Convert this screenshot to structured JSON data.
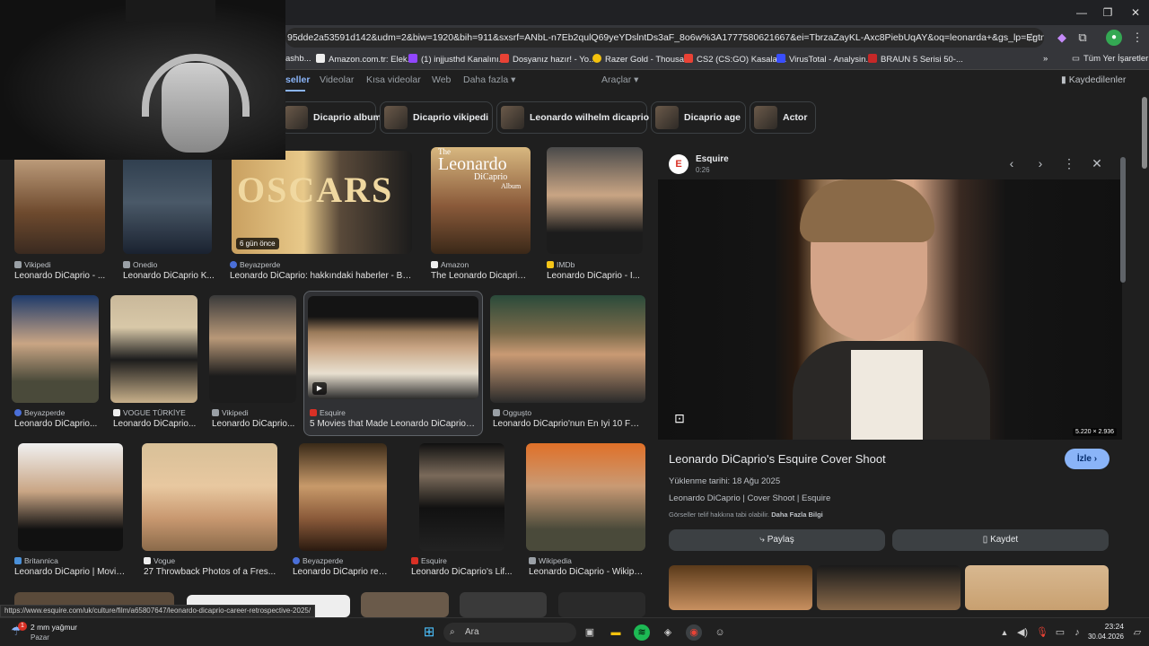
{
  "browser": {
    "url": "95dde2a53591d142&udm=2&biw=1920&bih=911&sxsrf=ANbL-n7Eb2qulQ69yeYDslntDs3aF_8o6w%3A1777580621667&ei=TbrzaZayKL-Axc8PiebUqAY&oq=leonarda+&gs_lp=Egtnd3Mtd2l6LWlt...",
    "bookmarks": [
      "ashb...",
      "Amazon.com.tr: Elek...",
      "(1) injjusthd Kanalını...",
      "Dosyanız hazır! - Yo...",
      "Razer Gold - Thousa...",
      "CS2 (CS:GO) Kasalar...",
      "VirusTotal - Analysin...",
      "BRAUN 5 Serisi 50-..."
    ],
    "all_bookmarks": "Tüm Yer İşaretleri",
    "status_url": "https://www.esquire.com/uk/culture/film/a65807647/leonardo-dicaprio-career-retrospective-2025/"
  },
  "tabs": {
    "items": [
      "seller",
      "Videolar",
      "Kısa videolar",
      "Web",
      "Daha fazla ▾"
    ],
    "tools": "Araçlar ▾",
    "saved": "Kaydedilenler"
  },
  "chips": [
    "Dicaprio album",
    "Dicaprio vikipedi",
    "Leonardo wilhelm dicaprio",
    "Dicaprio age",
    "Actor"
  ],
  "results": [
    {
      "src": "Vikipedi",
      "title": "Leonardo DiCaprio - ...",
      "color": "#9aa0a6"
    },
    {
      "src": "Onedio",
      "title": "Leonardo DiCaprio K...",
      "color": "#9aa0a6"
    },
    {
      "src": "Beyazperde",
      "title": "Leonardo DiCaprio: hakkındaki haberler - Bey...",
      "badge": "6 gün önce",
      "color": "#4a6fd8"
    },
    {
      "src": "Amazon",
      "title": "The Leonardo Dicaprio ...",
      "color": "#dddddd"
    },
    {
      "src": "IMDb",
      "title": "Leonardo DiCaprio - I...",
      "color": "#f5c518"
    },
    {
      "src": "Beyazperde",
      "title": "Leonardo DiCaprio...",
      "color": "#4a6fd8"
    },
    {
      "src": "VOGUE TÜRKİYE",
      "title": "Leonardo DiCaprio...",
      "color": "#dddddd"
    },
    {
      "src": "Vikipedi",
      "title": "Leonardo DiCaprio...",
      "color": "#9aa0a6"
    },
    {
      "src": "Esquire",
      "title": "5 Movies that Made Leonardo DiCaprio ...",
      "color": "#d93025"
    },
    {
      "src": "Ogguşto",
      "title": "Leonardo DiCaprio'nun En İyi 10 Fil...",
      "color": "#9aa0a6"
    },
    {
      "src": "Britannica",
      "title": "Leonardo DiCaprio | Movie...",
      "color": "#4a90d9"
    },
    {
      "src": "Vogue",
      "title": "27 Throwback Photos of a Fres...",
      "color": "#dddddd"
    },
    {
      "src": "Beyazperde",
      "title": "Leonardo DiCaprio resi...",
      "color": "#4a6fd8"
    },
    {
      "src": "Esquire",
      "title": "Leonardo DiCaprio's Lif...",
      "color": "#d93025"
    },
    {
      "src": "Wikipedia",
      "title": "Leonardo DiCaprio - Wikipe...",
      "color": "#9aa0a6"
    }
  ],
  "amazon_album": {
    "line1": "The",
    "line2": "Leonardo",
    "line3": "DiCaprio",
    "line4": "Album"
  },
  "oscars_text": "OSCARS",
  "panel": {
    "source": "Esquire",
    "duration": "0:26",
    "dimensions": "5.220 × 2.936",
    "title": "Leonardo DiCaprio's Esquire Cover Shoot",
    "watch": "İzle ›",
    "upload_date": "Yüklenme tarihi: 18 Ağu 2025",
    "subtitle": "Leonardo DiCaprio | Cover Shoot | Esquire",
    "copyright": "Görseller telif hakkına tabi olabilir.",
    "more_info": "Daha Fazla Bilgi",
    "share": "Paylaş",
    "save": "Kaydet"
  },
  "taskbar": {
    "weather_temp": "2 mm yağmur",
    "weather_day": "Pazar",
    "search": "Ara",
    "time": "23:24",
    "date": "30.04.2026",
    "badge": "1"
  }
}
